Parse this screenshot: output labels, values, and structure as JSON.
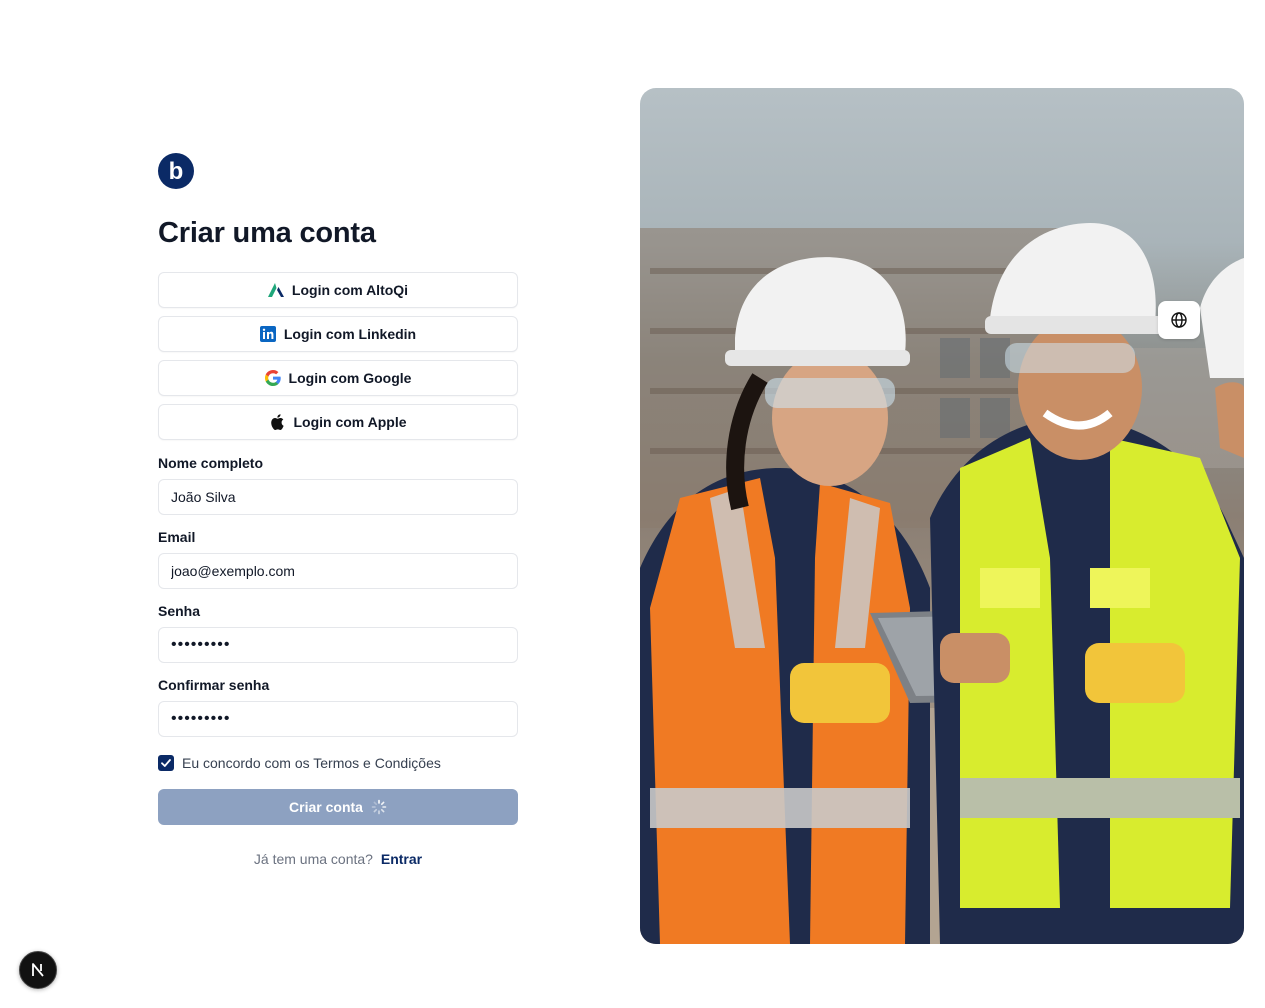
{
  "brand": {
    "logo_letter": "b",
    "color": "#0b2a66"
  },
  "page": {
    "title": "Criar uma conta"
  },
  "social_logins": [
    {
      "label": "Login com AltoQi",
      "icon": "altoqi-icon"
    },
    {
      "label": "Login com Linkedin",
      "icon": "linkedin-icon"
    },
    {
      "label": "Login com Google",
      "icon": "google-icon"
    },
    {
      "label": "Login com Apple",
      "icon": "apple-icon"
    }
  ],
  "form": {
    "full_name": {
      "label": "Nome completo",
      "value": "João Silva"
    },
    "email": {
      "label": "Email",
      "value": "joao@exemplo.com"
    },
    "password": {
      "label": "Senha",
      "value": "•••••••••"
    },
    "confirm_password": {
      "label": "Confirmar senha",
      "value": "•••••••••"
    },
    "terms": {
      "label": "Eu concordo com os Termos e Condições",
      "checked": true
    },
    "submit_label": "Criar conta"
  },
  "signin": {
    "prompt": "Já tem uma conta?",
    "link_label": "Entrar"
  },
  "colors": {
    "primary": "#0b2a66",
    "submit_disabled": "#8da1c1",
    "border": "#e5e7eb"
  }
}
